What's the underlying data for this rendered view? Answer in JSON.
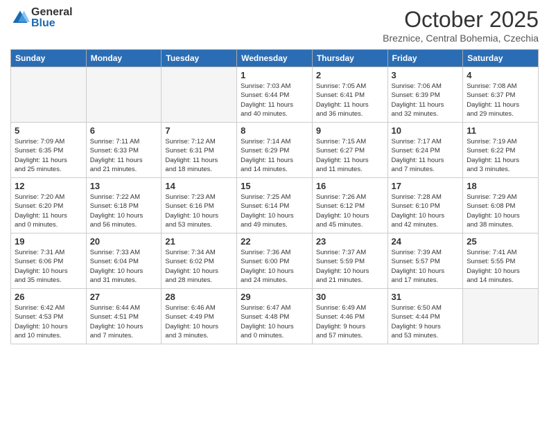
{
  "header": {
    "logo_general": "General",
    "logo_blue": "Blue",
    "month_title": "October 2025",
    "location": "Breznice, Central Bohemia, Czechia"
  },
  "days_of_week": [
    "Sunday",
    "Monday",
    "Tuesday",
    "Wednesday",
    "Thursday",
    "Friday",
    "Saturday"
  ],
  "weeks": [
    [
      {
        "day": "",
        "info": ""
      },
      {
        "day": "",
        "info": ""
      },
      {
        "day": "",
        "info": ""
      },
      {
        "day": "1",
        "info": "Sunrise: 7:03 AM\nSunset: 6:44 PM\nDaylight: 11 hours\nand 40 minutes."
      },
      {
        "day": "2",
        "info": "Sunrise: 7:05 AM\nSunset: 6:41 PM\nDaylight: 11 hours\nand 36 minutes."
      },
      {
        "day": "3",
        "info": "Sunrise: 7:06 AM\nSunset: 6:39 PM\nDaylight: 11 hours\nand 32 minutes."
      },
      {
        "day": "4",
        "info": "Sunrise: 7:08 AM\nSunset: 6:37 PM\nDaylight: 11 hours\nand 29 minutes."
      }
    ],
    [
      {
        "day": "5",
        "info": "Sunrise: 7:09 AM\nSunset: 6:35 PM\nDaylight: 11 hours\nand 25 minutes."
      },
      {
        "day": "6",
        "info": "Sunrise: 7:11 AM\nSunset: 6:33 PM\nDaylight: 11 hours\nand 21 minutes."
      },
      {
        "day": "7",
        "info": "Sunrise: 7:12 AM\nSunset: 6:31 PM\nDaylight: 11 hours\nand 18 minutes."
      },
      {
        "day": "8",
        "info": "Sunrise: 7:14 AM\nSunset: 6:29 PM\nDaylight: 11 hours\nand 14 minutes."
      },
      {
        "day": "9",
        "info": "Sunrise: 7:15 AM\nSunset: 6:27 PM\nDaylight: 11 hours\nand 11 minutes."
      },
      {
        "day": "10",
        "info": "Sunrise: 7:17 AM\nSunset: 6:24 PM\nDaylight: 11 hours\nand 7 minutes."
      },
      {
        "day": "11",
        "info": "Sunrise: 7:19 AM\nSunset: 6:22 PM\nDaylight: 11 hours\nand 3 minutes."
      }
    ],
    [
      {
        "day": "12",
        "info": "Sunrise: 7:20 AM\nSunset: 6:20 PM\nDaylight: 11 hours\nand 0 minutes."
      },
      {
        "day": "13",
        "info": "Sunrise: 7:22 AM\nSunset: 6:18 PM\nDaylight: 10 hours\nand 56 minutes."
      },
      {
        "day": "14",
        "info": "Sunrise: 7:23 AM\nSunset: 6:16 PM\nDaylight: 10 hours\nand 53 minutes."
      },
      {
        "day": "15",
        "info": "Sunrise: 7:25 AM\nSunset: 6:14 PM\nDaylight: 10 hours\nand 49 minutes."
      },
      {
        "day": "16",
        "info": "Sunrise: 7:26 AM\nSunset: 6:12 PM\nDaylight: 10 hours\nand 45 minutes."
      },
      {
        "day": "17",
        "info": "Sunrise: 7:28 AM\nSunset: 6:10 PM\nDaylight: 10 hours\nand 42 minutes."
      },
      {
        "day": "18",
        "info": "Sunrise: 7:29 AM\nSunset: 6:08 PM\nDaylight: 10 hours\nand 38 minutes."
      }
    ],
    [
      {
        "day": "19",
        "info": "Sunrise: 7:31 AM\nSunset: 6:06 PM\nDaylight: 10 hours\nand 35 minutes."
      },
      {
        "day": "20",
        "info": "Sunrise: 7:33 AM\nSunset: 6:04 PM\nDaylight: 10 hours\nand 31 minutes."
      },
      {
        "day": "21",
        "info": "Sunrise: 7:34 AM\nSunset: 6:02 PM\nDaylight: 10 hours\nand 28 minutes."
      },
      {
        "day": "22",
        "info": "Sunrise: 7:36 AM\nSunset: 6:00 PM\nDaylight: 10 hours\nand 24 minutes."
      },
      {
        "day": "23",
        "info": "Sunrise: 7:37 AM\nSunset: 5:59 PM\nDaylight: 10 hours\nand 21 minutes."
      },
      {
        "day": "24",
        "info": "Sunrise: 7:39 AM\nSunset: 5:57 PM\nDaylight: 10 hours\nand 17 minutes."
      },
      {
        "day": "25",
        "info": "Sunrise: 7:41 AM\nSunset: 5:55 PM\nDaylight: 10 hours\nand 14 minutes."
      }
    ],
    [
      {
        "day": "26",
        "info": "Sunrise: 6:42 AM\nSunset: 4:53 PM\nDaylight: 10 hours\nand 10 minutes."
      },
      {
        "day": "27",
        "info": "Sunrise: 6:44 AM\nSunset: 4:51 PM\nDaylight: 10 hours\nand 7 minutes."
      },
      {
        "day": "28",
        "info": "Sunrise: 6:46 AM\nSunset: 4:49 PM\nDaylight: 10 hours\nand 3 minutes."
      },
      {
        "day": "29",
        "info": "Sunrise: 6:47 AM\nSunset: 4:48 PM\nDaylight: 10 hours\nand 0 minutes."
      },
      {
        "day": "30",
        "info": "Sunrise: 6:49 AM\nSunset: 4:46 PM\nDaylight: 9 hours\nand 57 minutes."
      },
      {
        "day": "31",
        "info": "Sunrise: 6:50 AM\nSunset: 4:44 PM\nDaylight: 9 hours\nand 53 minutes."
      },
      {
        "day": "",
        "info": ""
      }
    ]
  ]
}
